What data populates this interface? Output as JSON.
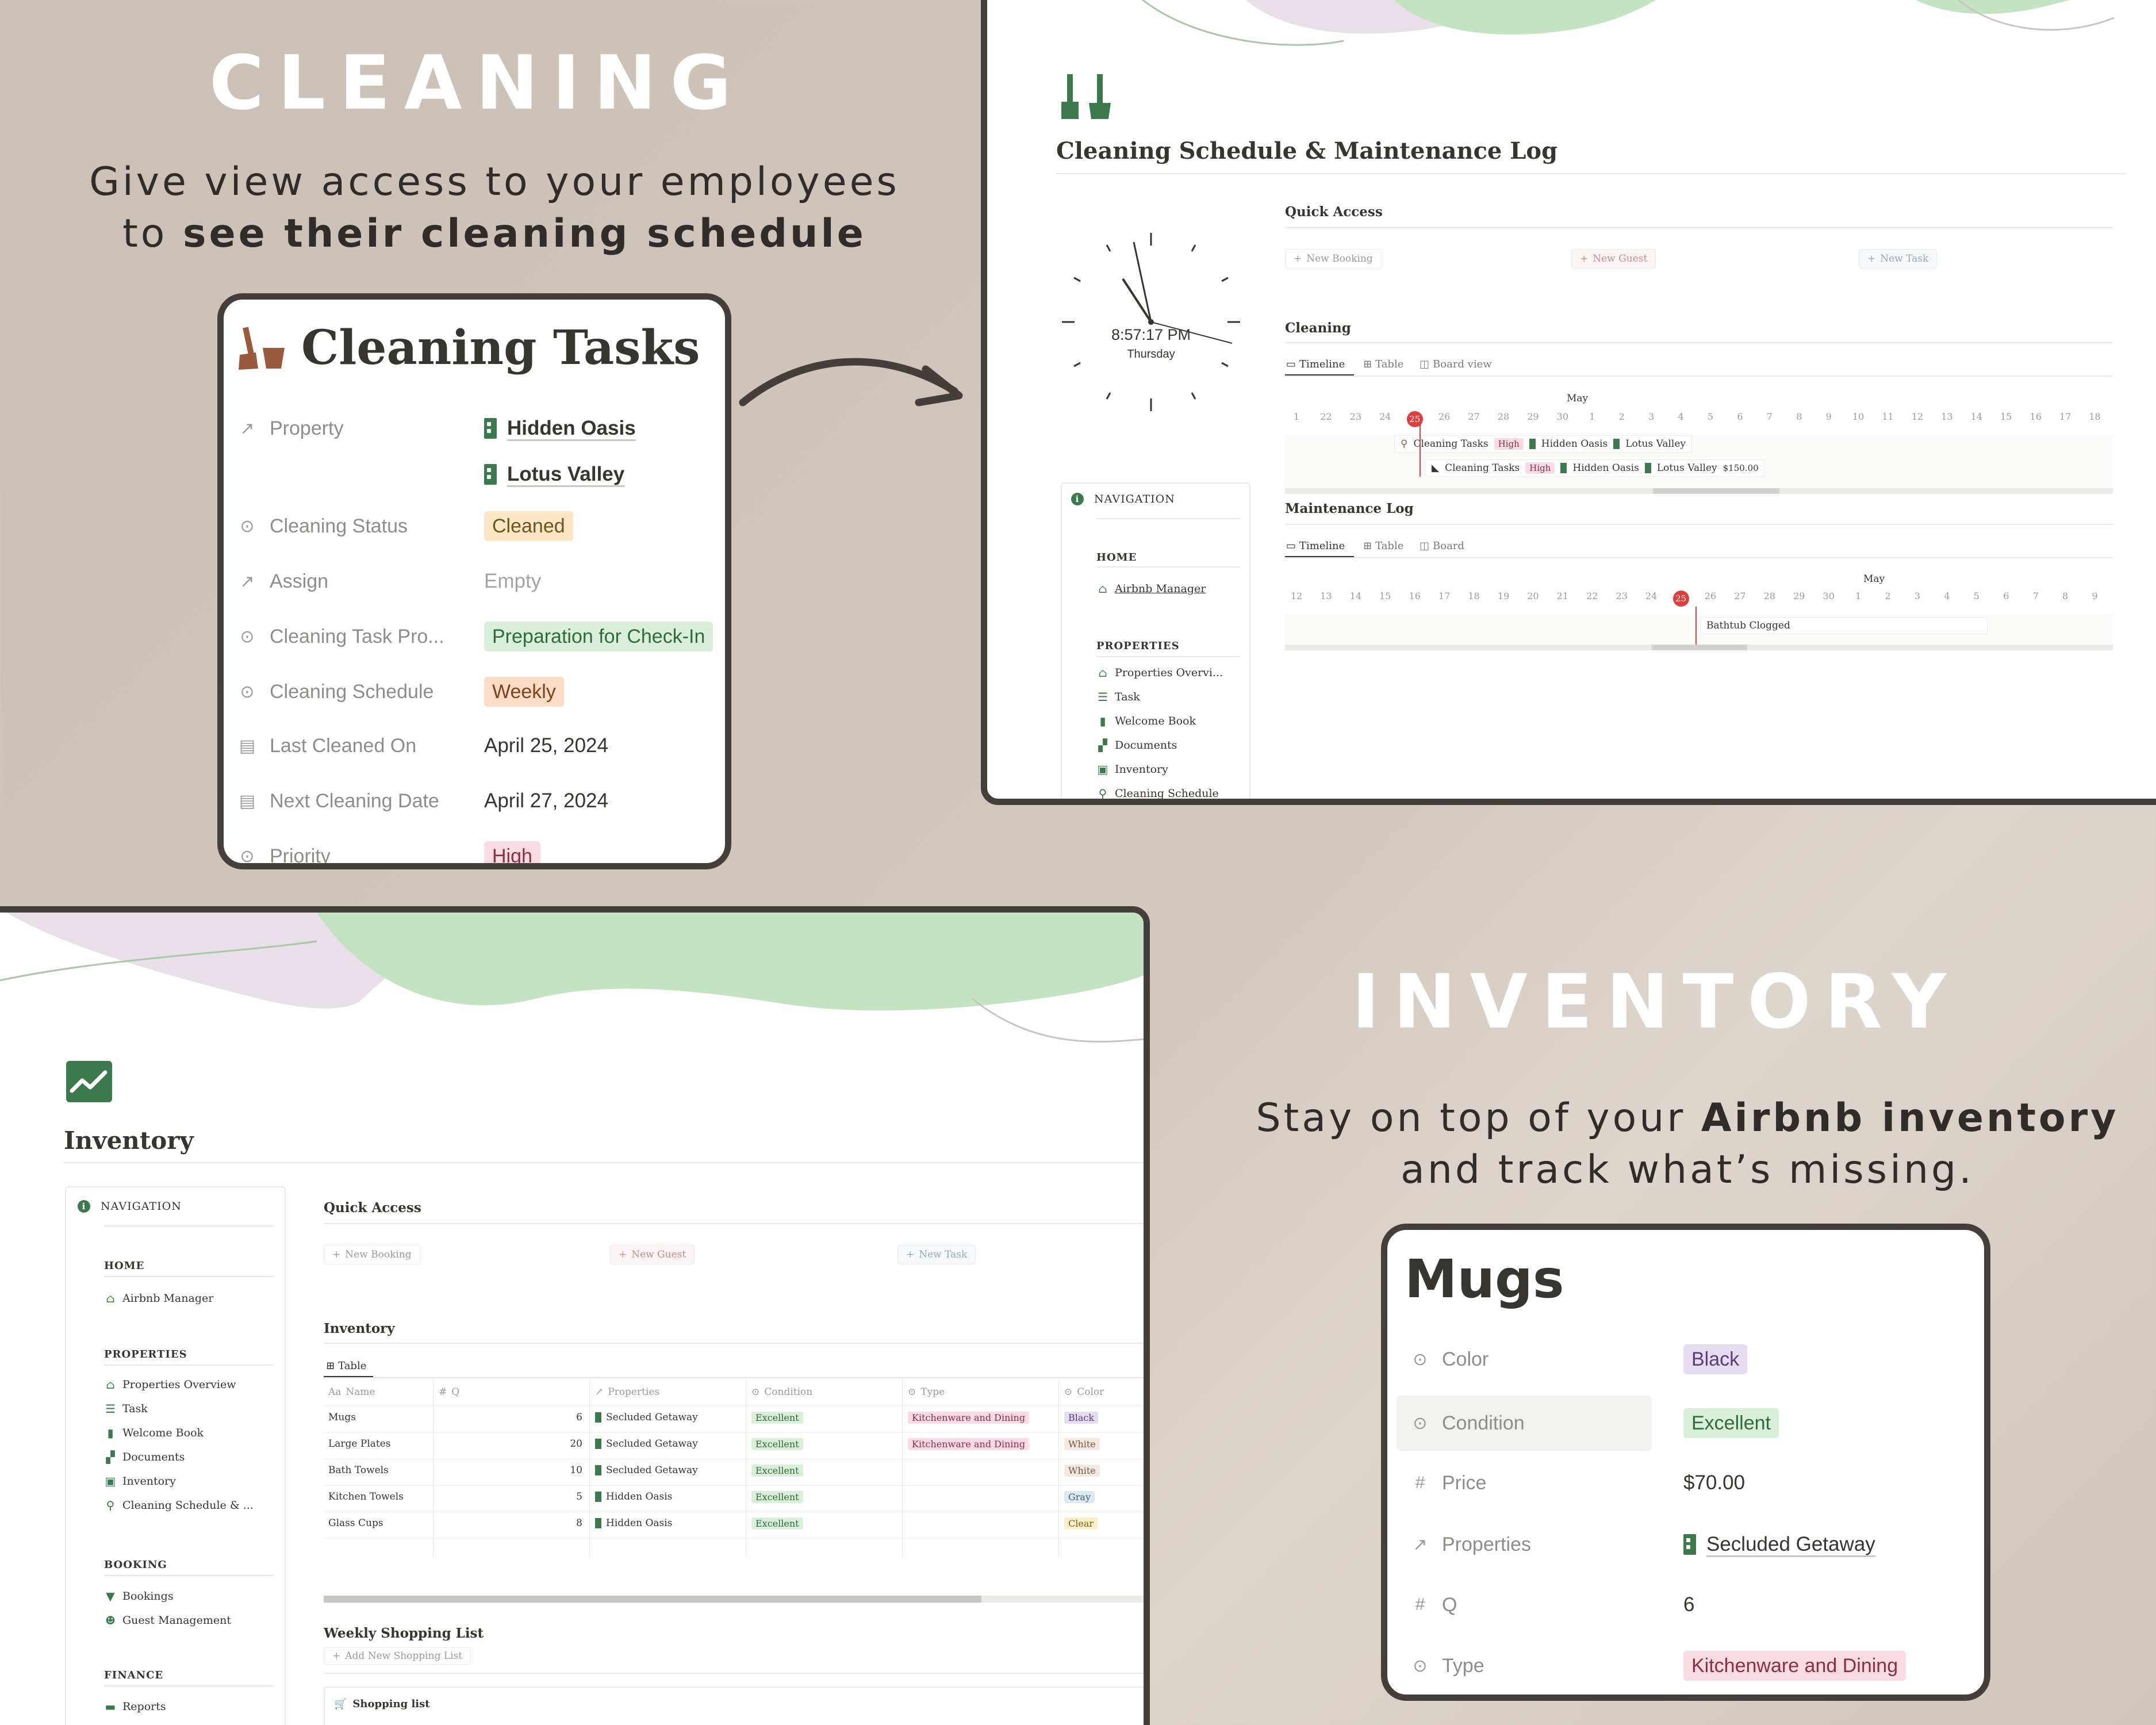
{
  "cleaning_promo": {
    "title": "CLEANING",
    "subtitle_line1": "Give view access to your employees",
    "subtitle_line2_prefix": "to ",
    "subtitle_line2_bold": "see their cleaning schedule"
  },
  "cleaning_card": {
    "title": "Cleaning Tasks",
    "properties": [
      {
        "name": "Property",
        "values": [
          "Hidden Oasis",
          "Lotus Valley"
        ]
      },
      {
        "name": "Cleaning Status",
        "value": "Cleaned"
      },
      {
        "name": "Assign",
        "value": "Empty"
      },
      {
        "name": "Cleaning Task Pro...",
        "value": "Preparation for Check-In"
      },
      {
        "name": "Cleaning Schedule",
        "value": "Weekly"
      },
      {
        "name": "Last Cleaned On",
        "value": "April 25, 2024"
      },
      {
        "name": "Next Cleaning Date",
        "value": "April 27, 2024"
      },
      {
        "name": "Priority",
        "value": "High"
      }
    ]
  },
  "schedule_window": {
    "page_title": "Cleaning Schedule & Maintenance Log",
    "clock_time": "8:57:17 PM",
    "clock_day": "Thursday",
    "quick_access_title": "Quick Access",
    "quick_buttons": [
      "New Booking",
      "New Guest",
      "New Task"
    ],
    "cleaning_title": "Cleaning",
    "cleaning_tabs": [
      "Timeline",
      "Table",
      "Board view"
    ],
    "month": "May",
    "cleaning_days": [
      "1",
      "22",
      "23",
      "24",
      "25",
      "26",
      "27",
      "28",
      "29",
      "30",
      "1",
      "2",
      "3",
      "4",
      "5",
      "6",
      "7",
      "8",
      "9",
      "10",
      "11",
      "12",
      "13",
      "14",
      "15",
      "16",
      "17",
      "18"
    ],
    "cleaning_items": [
      {
        "name": "Cleaning Tasks",
        "priority": "High",
        "props": [
          "Hidden Oasis",
          "Lotus Valley"
        ],
        "price": ""
      },
      {
        "name": "Cleaning Tasks",
        "priority": "High",
        "props": [
          "Hidden Oasis",
          "Lotus Valley"
        ],
        "price": "$150.00"
      }
    ],
    "maintenance_title": "Maintenance Log",
    "maintenance_tabs": [
      "Timeline",
      "Table",
      "Board"
    ],
    "maintenance_days": [
      "12",
      "13",
      "14",
      "15",
      "16",
      "17",
      "18",
      "19",
      "20",
      "21",
      "22",
      "23",
      "24",
      "25",
      "26",
      "27",
      "28",
      "29",
      "30",
      "1",
      "2",
      "3",
      "4",
      "5",
      "6",
      "7",
      "8",
      "9"
    ],
    "maintenance_item": "Bathtub Clogged",
    "nav": {
      "heading": "NAVIGATION",
      "home_label": "HOME",
      "home_items": [
        "Airbnb Manager"
      ],
      "properties_label": "PROPERTIES",
      "property_items": [
        "Properties Overvi...",
        "Task",
        "Welcome Book",
        "Documents",
        "Inventory",
        "Cleaning Schedule"
      ]
    }
  },
  "inventory_window": {
    "page_title": "Inventory",
    "nav": {
      "heading": "NAVIGATION",
      "home_label": "HOME",
      "home_items": [
        "Airbnb Manager"
      ],
      "properties_label": "PROPERTIES",
      "property_items": [
        "Properties Overview",
        "Task",
        "Welcome Book",
        "Documents",
        "Inventory",
        "Cleaning Schedule & ..."
      ],
      "booking_label": "BOOKING",
      "booking_items": [
        "Bookings",
        "Guest Management"
      ],
      "finance_label": "FINANCE",
      "finance_items": [
        "Reports"
      ]
    },
    "quick_access_title": "Quick Access",
    "quick_buttons": [
      "New Booking",
      "New Guest",
      "New Task"
    ],
    "inventory_title": "Inventory",
    "table_tab": "Table",
    "columns": [
      "Name",
      "Q",
      "Properties",
      "Condition",
      "Type",
      "Color"
    ],
    "rows": [
      {
        "name": "Mugs",
        "q": "6",
        "property": "Secluded Getaway",
        "condition": "Excellent",
        "type": "Kitchenware and Dining",
        "color": "Black"
      },
      {
        "name": "Large Plates",
        "q": "20",
        "property": "Secluded Getaway",
        "condition": "Excellent",
        "type": "Kitchenware and Dining",
        "color": "White"
      },
      {
        "name": "Bath Towels",
        "q": "10",
        "property": "Secluded Getaway",
        "condition": "Excellent",
        "type": "",
        "color": "White"
      },
      {
        "name": "Kitchen Towels",
        "q": "5",
        "property": "Hidden Oasis",
        "condition": "Excellent",
        "type": "",
        "color": "Gray"
      },
      {
        "name": "Glass Cups",
        "q": "8",
        "property": "Hidden Oasis",
        "condition": "Excellent",
        "type": "",
        "color": "Clear"
      }
    ],
    "shopping_title": "Weekly Shopping List",
    "shopping_button": "Add New Shopping List",
    "shopping_item": "Shopping list"
  },
  "inventory_promo": {
    "title": "INVENTORY",
    "subtitle_line1_prefix": "Stay on top of your ",
    "subtitle_line1_bold": "Airbnb inventory",
    "subtitle_line2": "and track what’s missing."
  },
  "mugs_card": {
    "title": "Mugs",
    "properties": [
      {
        "name": "Color",
        "value": "Black"
      },
      {
        "name": "Condition",
        "value": "Excellent"
      },
      {
        "name": "Price",
        "value": "$70.00"
      },
      {
        "name": "Properties",
        "value": "Secluded Getaway"
      },
      {
        "name": "Q",
        "value": "6"
      },
      {
        "name": "Type",
        "value": "Kitchenware and Dining"
      }
    ]
  },
  "colors": {
    "background": "#cbc0b5",
    "frame": "#453f3b",
    "accent_green": "#3c7a4e",
    "today_red": "#e03e3e"
  }
}
